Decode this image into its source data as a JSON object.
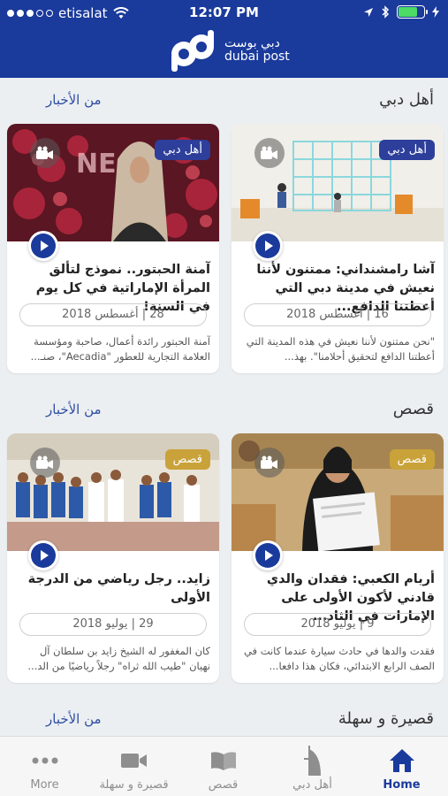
{
  "status_bar": {
    "carrier": "etisalat",
    "time": "12:07 PM",
    "battery_percent": 75
  },
  "header": {
    "logo_ar": "دبي بوست",
    "logo_en": "dubai post",
    "brand_color": "#1a3a9c"
  },
  "sections": [
    {
      "title": "أهل دبي",
      "more_label": "من الأخبار",
      "cards": [
        {
          "badge": "أهل دبي",
          "badge_color": "#2d3f9a",
          "title": "آشا رامشنداني: ممتنون لأننا نعيش في مدينة دبي التي أعطتنا الدافع...",
          "date": "16 | أغسطس 2018",
          "excerpt": "\"نحن ممتنون لأننا نعيش في هذه المدينة التي أعطتنا الدافع لتحقيق أحلامنا\". بهذ..."
        },
        {
          "badge": "أهل دبي",
          "badge_color": "#2d3f9a",
          "title": "آمنة الحبتور.. نموذج لتألق المرأة الإماراتية في كل يوم في السنة!",
          "date": "28 | أغسطس 2018",
          "excerpt": "آمنة الحبتور رائدة أعمال، صاحبة ومؤسسة العلامة التجارية للعطور \"Aecadia\"، صنـ..."
        }
      ]
    },
    {
      "title": "قصص",
      "more_label": "من الأخبار",
      "cards": [
        {
          "badge": "قصص",
          "badge_color": "#c9a23a",
          "title": "أريام الكعبي: فقدان والدي قادني لأكون الأولى على الإمارات في الثاد...",
          "date": "9 | يوليو 2018",
          "excerpt": "فقدت والدها في حادث سيارة عندما كانت في الصف الرابع الابتدائي، فكان هذا دافعا..."
        },
        {
          "badge": "قصص",
          "badge_color": "#c9a23a",
          "title": "زايد.. رجل رياضي من الدرجة الأولى",
          "date": "29 | يوليو 2018",
          "excerpt": "كان المغفور له الشيخ زايد بن سلطان آل نهيان \"طيب الله ثراه\" رجلاً رياضيًا من الد..."
        }
      ]
    },
    {
      "title": "قصيرة و سهلة",
      "more_label": "من الأخبار",
      "cards": []
    }
  ],
  "tabbar": {
    "items": [
      {
        "label": "More",
        "icon": "more-dots-icon"
      },
      {
        "label": "قصيرة و سهلة",
        "icon": "video-camera-icon"
      },
      {
        "label": "قصص",
        "icon": "open-book-icon"
      },
      {
        "label": "أهل دبي",
        "icon": "burj-al-arab-icon"
      },
      {
        "label": "Home",
        "icon": "home-icon",
        "active": true
      }
    ],
    "active_color": "#1a3a9c",
    "inactive_color": "#8e8e8e"
  }
}
